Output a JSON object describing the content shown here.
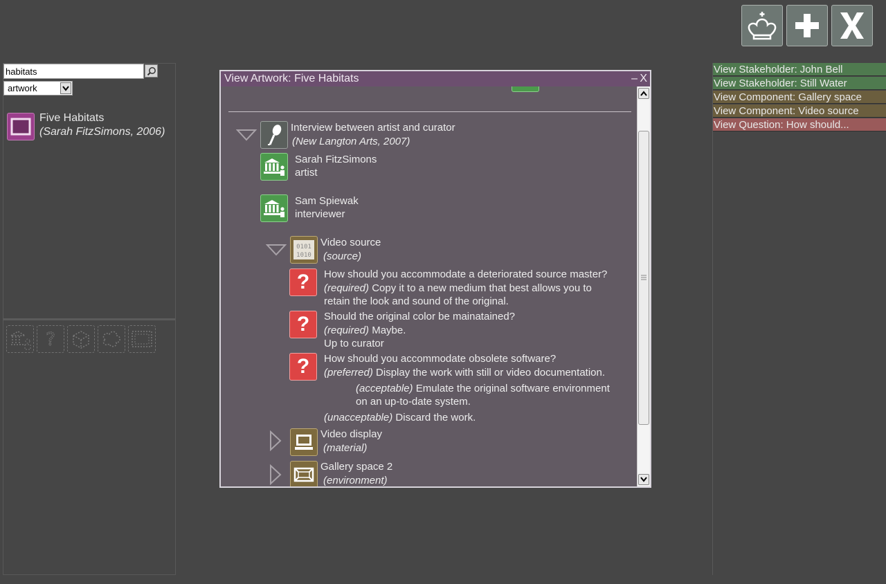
{
  "toolbar": {
    "home_icon": "chess-king-icon",
    "add_icon": "plus-icon",
    "close_icon": "x-icon"
  },
  "left_panel": {
    "search_value": "habitats",
    "type_select": "artwork",
    "result": {
      "title": "Five Habitats",
      "subtitle": "(Sarah FitzSimons, 2006)"
    },
    "tools": [
      "stakeholder-tool-icon",
      "question-tool-icon",
      "component-tool-icon",
      "cluster-tool-icon",
      "frame-tool-icon"
    ]
  },
  "right_panel": {
    "items": [
      {
        "label": "View Stakeholder: John Bell",
        "color": "#4f7a4f"
      },
      {
        "label": "View Stakeholder: Still Water",
        "color": "#4f7a4f"
      },
      {
        "label": "View Component: Gallery space",
        "color": "#6b5e3e"
      },
      {
        "label": "View Component: Video source",
        "color": "#6b5e3e"
      },
      {
        "label": "View Question: How should...",
        "color": "#9a5a5a"
      }
    ]
  },
  "dialog": {
    "title": "View Artwork: Five Habitats",
    "minimize": "–",
    "close": "X",
    "interview": {
      "title": "Interview between artist and curator",
      "subtitle": "(New Langton Arts, 2007)"
    },
    "people": [
      {
        "name": "Sarah FitzSimons",
        "role": "artist"
      },
      {
        "name": "Sam Spiewak",
        "role": "interviewer"
      }
    ],
    "video_source": {
      "title": "Video source",
      "subtitle": "(source)"
    },
    "questions": [
      {
        "q": "How should you accommodate a deteriorated source master?",
        "level": "(required)",
        "a1": " Copy it to a new medium that best allows you to",
        "a2": "retain the look and sound of the original."
      },
      {
        "q": "Should the original color be mainatained?",
        "level": "(required)",
        "a1": " Maybe.",
        "a2": "Up to curator"
      },
      {
        "q": "How should you accommodate obsolete software?",
        "level": "(preferred)",
        "a1": " Display the work with still or video documentation."
      }
    ],
    "acceptable": {
      "level": "(acceptable)",
      "a1": " Emulate the original software environment",
      "a2": "on an up-to-date system."
    },
    "unacceptable": {
      "level": "(unacceptable)",
      "a1": " Discard the work."
    },
    "video_display": {
      "title": "Video display",
      "subtitle": "(material)"
    },
    "gallery_space": {
      "title": "Gallery space 2",
      "subtitle": "(environment)"
    }
  }
}
